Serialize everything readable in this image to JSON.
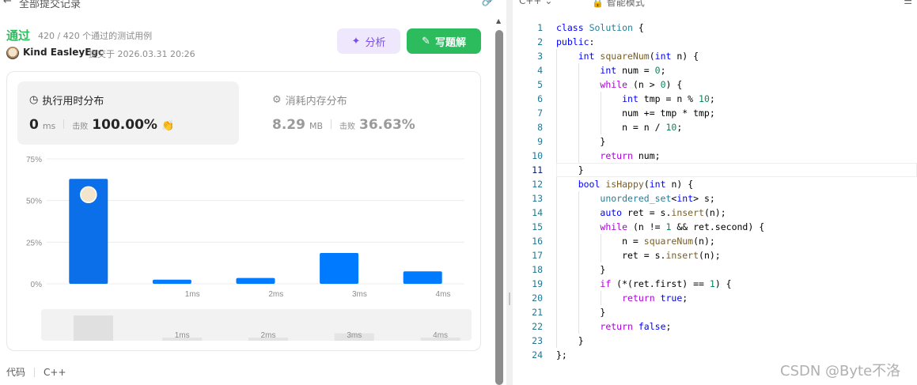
{
  "topbar": {
    "back_icon": "arrow-left-icon",
    "title": "全部提交记录",
    "link_icon": "link-icon"
  },
  "submission": {
    "status": "通过",
    "passed_text": "420 / 420 个通过的测试用例",
    "user": "Kind EasleyEgc",
    "submitted_at": "提交于 2026.03.31 20:26"
  },
  "buttons": {
    "analyze": "分析",
    "solution": "写题解"
  },
  "runtime": {
    "title": "执行用时分布",
    "value": "0",
    "unit": "ms",
    "beat_label": "击败",
    "beat_pct": "100.00%"
  },
  "memory": {
    "title": "消耗内存分布",
    "value": "8.29",
    "unit": "MB",
    "beat_label": "击败",
    "beat_pct": "36.63%"
  },
  "chart_data": {
    "type": "bar",
    "categories": [
      "0ms",
      "1ms",
      "2ms",
      "3ms",
      "4ms"
    ],
    "tick_labels": [
      "",
      "1ms",
      "2ms",
      "3ms",
      "4ms"
    ],
    "values": [
      63,
      2.5,
      3.5,
      18.5,
      7.5
    ],
    "ylim": [
      0,
      75
    ],
    "yticks": [
      "0%",
      "25%",
      "50%",
      "75%"
    ],
    "grid": true,
    "highlight_index": 0,
    "brush_labels": [
      "",
      "1ms",
      "2ms",
      "3ms",
      "4ms"
    ],
    "colors": {
      "bar": "#007aff",
      "highlight": "#0a6fe8",
      "grid": "#ececec"
    }
  },
  "footer": {
    "label": "代码",
    "lang": "C++"
  },
  "editor": {
    "lang": "C++",
    "mode": "智能模式",
    "menu_icon": "menu-icon",
    "current_line": 11,
    "lines": [
      "class Solution {",
      "public:",
      "    int squareNum(int n) {",
      "        int num = 0;",
      "        while (n > 0) {",
      "            int tmp = n % 10;",
      "            num += tmp * tmp;",
      "            n = n / 10;",
      "        }",
      "        return num;",
      "    }",
      "    bool isHappy(int n) {",
      "        unordered_set<int> s;",
      "        auto ret = s.insert(n);",
      "        while (n != 1 && ret.second) {",
      "            n = squareNum(n);",
      "            ret = s.insert(n);",
      "        }",
      "        if (*(ret.first) == 1) {",
      "            return true;",
      "        }",
      "        return false;",
      "    }",
      "};"
    ]
  },
  "watermark": "CSDN @Byte不洛"
}
